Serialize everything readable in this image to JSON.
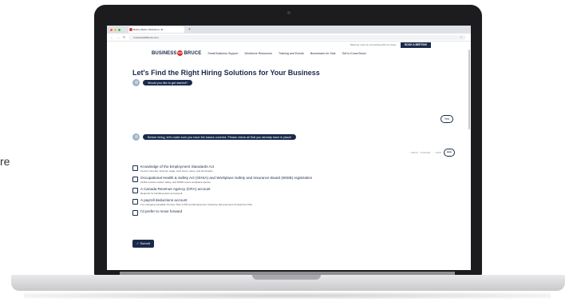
{
  "side_text": "re",
  "browser": {
    "tab_title": "Build a Better Workforce | B...",
    "new_tab_label": "+",
    "url": "businesswithbruce.com",
    "back_icon": "left-arrow-icon",
    "forward_icon": "right-arrow-icon",
    "reload_icon": "reload-icon"
  },
  "site": {
    "topbar": {
      "discover_text": "Discover more by connecting with our team.",
      "book_label": "BOOK A MEETING"
    },
    "logo": {
      "left": "BUSINESS",
      "mark": "with",
      "right": "BRUCE"
    },
    "nav": [
      "Small Business Support",
      "Workforce Resources",
      "Training and Events",
      "Businesses for Sale",
      "Get to Know Bruce"
    ]
  },
  "chat": {
    "heading": "Let's Find the Right Hiring Solutions for Your Business",
    "bot_msg_1": "Would you like to get started?",
    "user_reply": "Yes",
    "bot_msg_2": "Before hiring, let's make sure you have the basics covered. Please check all that you already have in place!",
    "controls": {
      "back": "← BACK",
      "pause": "II PAUSE",
      "skip": "→ SKIP",
      "dots": "•••"
    }
  },
  "options": [
    {
      "title": "Knowledge of the Employment Standards Act",
      "desc": "Covers rules like minimum wage, work hours, leave, and termination."
    },
    {
      "title": "Occupational Health & Safety Act (OHSA) and Workplace Safety and Insurance Board (WSIB) registration",
      "desc": "OHSA ensures worker safety, and WSIB covers workplace injuries."
    },
    {
      "title": "A Canada Revenue Agency (CRA) account",
      "desc": "Required for handling taxes and payroll."
    },
    {
      "title": "A payroll deductions account",
      "desc": "For managing Canadian Pension Plan (CPP) and Employment Insurance (EI) payments through the CRA."
    },
    {
      "title": "I'd prefer to move forward",
      "desc": ""
    }
  ],
  "submit_label": "✓ Submit",
  "colors": {
    "navy": "#1b2a4a",
    "brand_red": "#d9302c",
    "laptop_bezel": "#1c1c1e"
  }
}
